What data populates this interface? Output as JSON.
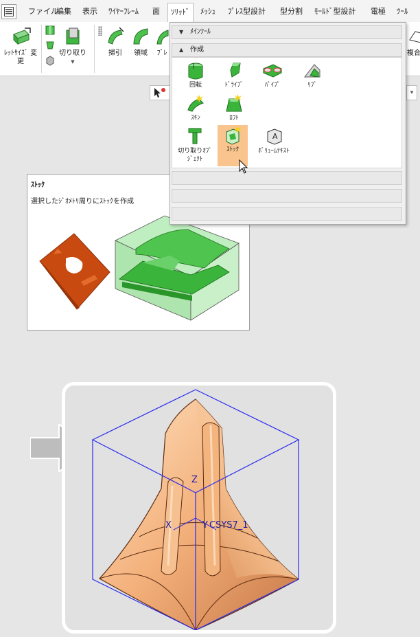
{
  "menubar": {
    "tabs": [
      {
        "label": "ファイル"
      },
      {
        "label": "編集"
      },
      {
        "label": "表示"
      },
      {
        "label": "ﾜｲﾔｰﾌﾚｰﾑ"
      },
      {
        "label": "面"
      },
      {
        "label": "ｿﾘｯﾄﾞ",
        "active": true
      },
      {
        "label": "ﾒｯｼｭ"
      },
      {
        "label": "ﾌﾟﾚｽ型設計"
      },
      {
        "label": "型分割"
      },
      {
        "label": "ﾓｰﾙﾄﾞ型設計"
      },
      {
        "label": "電極"
      },
      {
        "label": "ﾂｰﾙ"
      }
    ]
  },
  "ribbon": {
    "resize_label_1": "ﾚｯﾄｻｲｽﾞ 変",
    "resize_label_2": "更",
    "cut_label": "切り取り",
    "sweep_label": "掃引",
    "region_label": "領域",
    "blend_label": "ﾌﾞﾚ",
    "composite_label": "複合"
  },
  "dropdown": {
    "main_tools_header": "ﾒｲﾝﾂｰﾙ",
    "create_header": "作成",
    "tools": {
      "revolve": "回転",
      "drive": "ﾄﾞﾗｲﾌﾞ",
      "pipe": "ﾊﾟｲﾌﾟ",
      "rib": "ﾘﾌﾞ",
      "skin": "ｽｷﾝ",
      "loft": "ﾛﾌﾄ",
      "cut_object_1": "切り取りｵﾌﾞ",
      "cut_object_2": "ｼﾞｪｸﾄ",
      "stock": "ｽﾄｯｸ",
      "volume_text": "ﾎﾞﾘｭｰﾑﾃｷｽﾄ"
    }
  },
  "tooltip": {
    "title": "ｽﾄｯｸ",
    "description": "選択したｼﾞｵﾒﾄﾘ周りにｽﾄｯｸを作成"
  },
  "viewport": {
    "axis_z": "Z",
    "axis_x": "X",
    "axis_y": "Y",
    "csys_label": "CSYS7_1"
  },
  "colors": {
    "highlight": "#f9c48d",
    "stock_green": "#2fb82f",
    "part_orange": "#c84a10",
    "bounding_box_blue": "#2a2af0"
  }
}
